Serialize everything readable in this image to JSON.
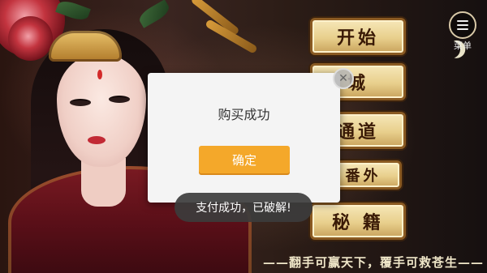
{
  "game": {
    "menu_items": [
      "开始",
      "城",
      "通道",
      "番外",
      "秘 籍"
    ],
    "menu_icon_label": "菜单",
    "slogan": "——翻手可赢天下，覆手可救苍生——"
  },
  "dialog": {
    "title": "购买成功",
    "confirm_label": "确定",
    "close_icon": "close-icon"
  },
  "toast": {
    "message": "支付成功，已破解!"
  },
  "colors": {
    "confirm_button": "#f4a82a",
    "dialog_bg": "#f4f4f4",
    "toast_bg": "#3c3c3c",
    "menu_button": "#e8cf8c"
  }
}
